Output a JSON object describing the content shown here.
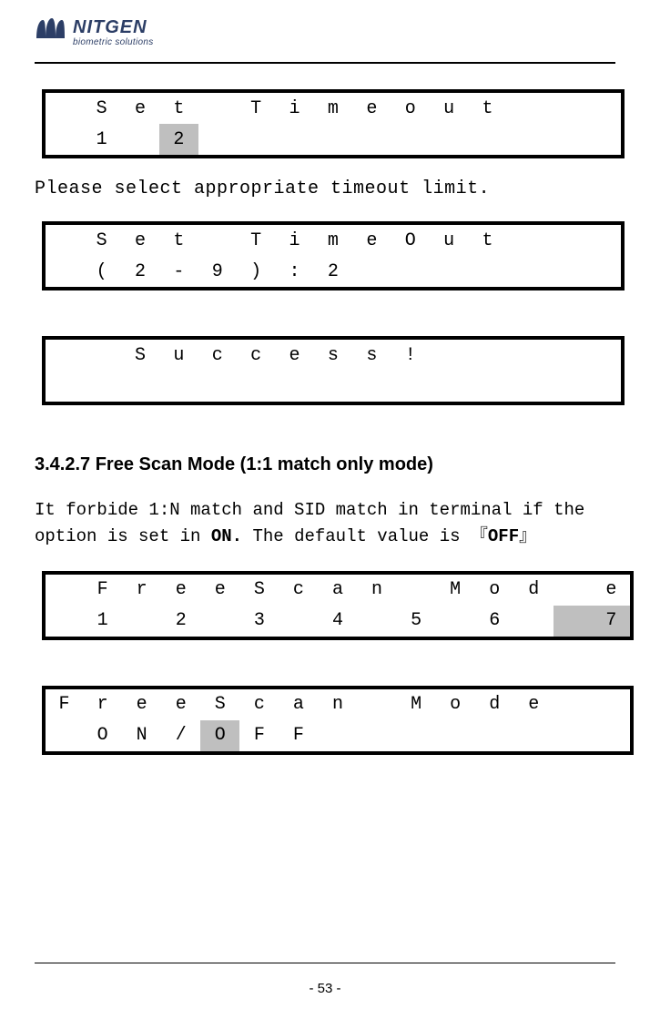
{
  "brand": {
    "name": "NITGEN",
    "tagline": "biometric solutions"
  },
  "lcd1": {
    "row1": [
      "",
      "S",
      "e",
      "t",
      "",
      "T",
      "i",
      "m",
      "e",
      "o",
      "u",
      "t",
      "",
      "",
      ""
    ],
    "row2": [
      "",
      "1",
      "",
      "2",
      "",
      "",
      "",
      "",
      "",
      "",
      "",
      "",
      "",
      "",
      ""
    ],
    "row2_hl": [
      false,
      false,
      false,
      true,
      false,
      false,
      false,
      false,
      false,
      false,
      false,
      false,
      false,
      false,
      false
    ]
  },
  "text1": "Please select appropriate timeout limit.",
  "lcd2": {
    "row1": [
      "",
      "S",
      "e",
      "t",
      "",
      "T",
      "i",
      "m",
      "e",
      "O",
      "u",
      "t",
      "",
      "",
      ""
    ],
    "row2": [
      "",
      "(",
      "2",
      "-",
      "9",
      ")",
      ":",
      "2",
      "",
      "",
      "",
      "",
      "",
      "",
      ""
    ]
  },
  "lcd3": {
    "row1": [
      "",
      "",
      "S",
      "u",
      "c",
      "c",
      "e",
      "s",
      "s",
      "!",
      "",
      "",
      "",
      "",
      ""
    ]
  },
  "section": "3.4.2.7 Free Scan Mode (1:1 match only mode)",
  "para_pre": "It forbide 1:N match and SID match in terminal if the option is set in ",
  "para_on": "ON.",
  "para_mid": " The default value is 『",
  "para_off": "OFF",
  "para_post": "』",
  "lcd4": {
    "row1": [
      "",
      "F",
      "r",
      "e",
      "e",
      "S",
      "c",
      "a",
      "n",
      "",
      "M",
      "o",
      "d",
      "",
      "e"
    ],
    "row2": [
      "",
      "1",
      "",
      "2",
      "",
      "3",
      "",
      "4",
      "",
      "5",
      "",
      "6",
      "",
      "",
      "7"
    ],
    "row2_hl": [
      false,
      false,
      false,
      false,
      false,
      false,
      false,
      false,
      false,
      false,
      false,
      false,
      false,
      true,
      true
    ]
  },
  "lcd5": {
    "row1": [
      "F",
      "r",
      "e",
      "e",
      "S",
      "c",
      "a",
      "n",
      "",
      "M",
      "o",
      "d",
      "e",
      "",
      ""
    ],
    "row2": [
      "",
      "O",
      "N",
      "/",
      "O",
      "F",
      "F",
      "",
      "",
      "",
      "",
      "",
      "",
      "",
      ""
    ],
    "row2_hl": [
      false,
      false,
      false,
      false,
      true,
      false,
      false,
      false,
      false,
      false,
      false,
      false,
      false,
      false,
      false
    ]
  },
  "page_number": "- 53 -"
}
